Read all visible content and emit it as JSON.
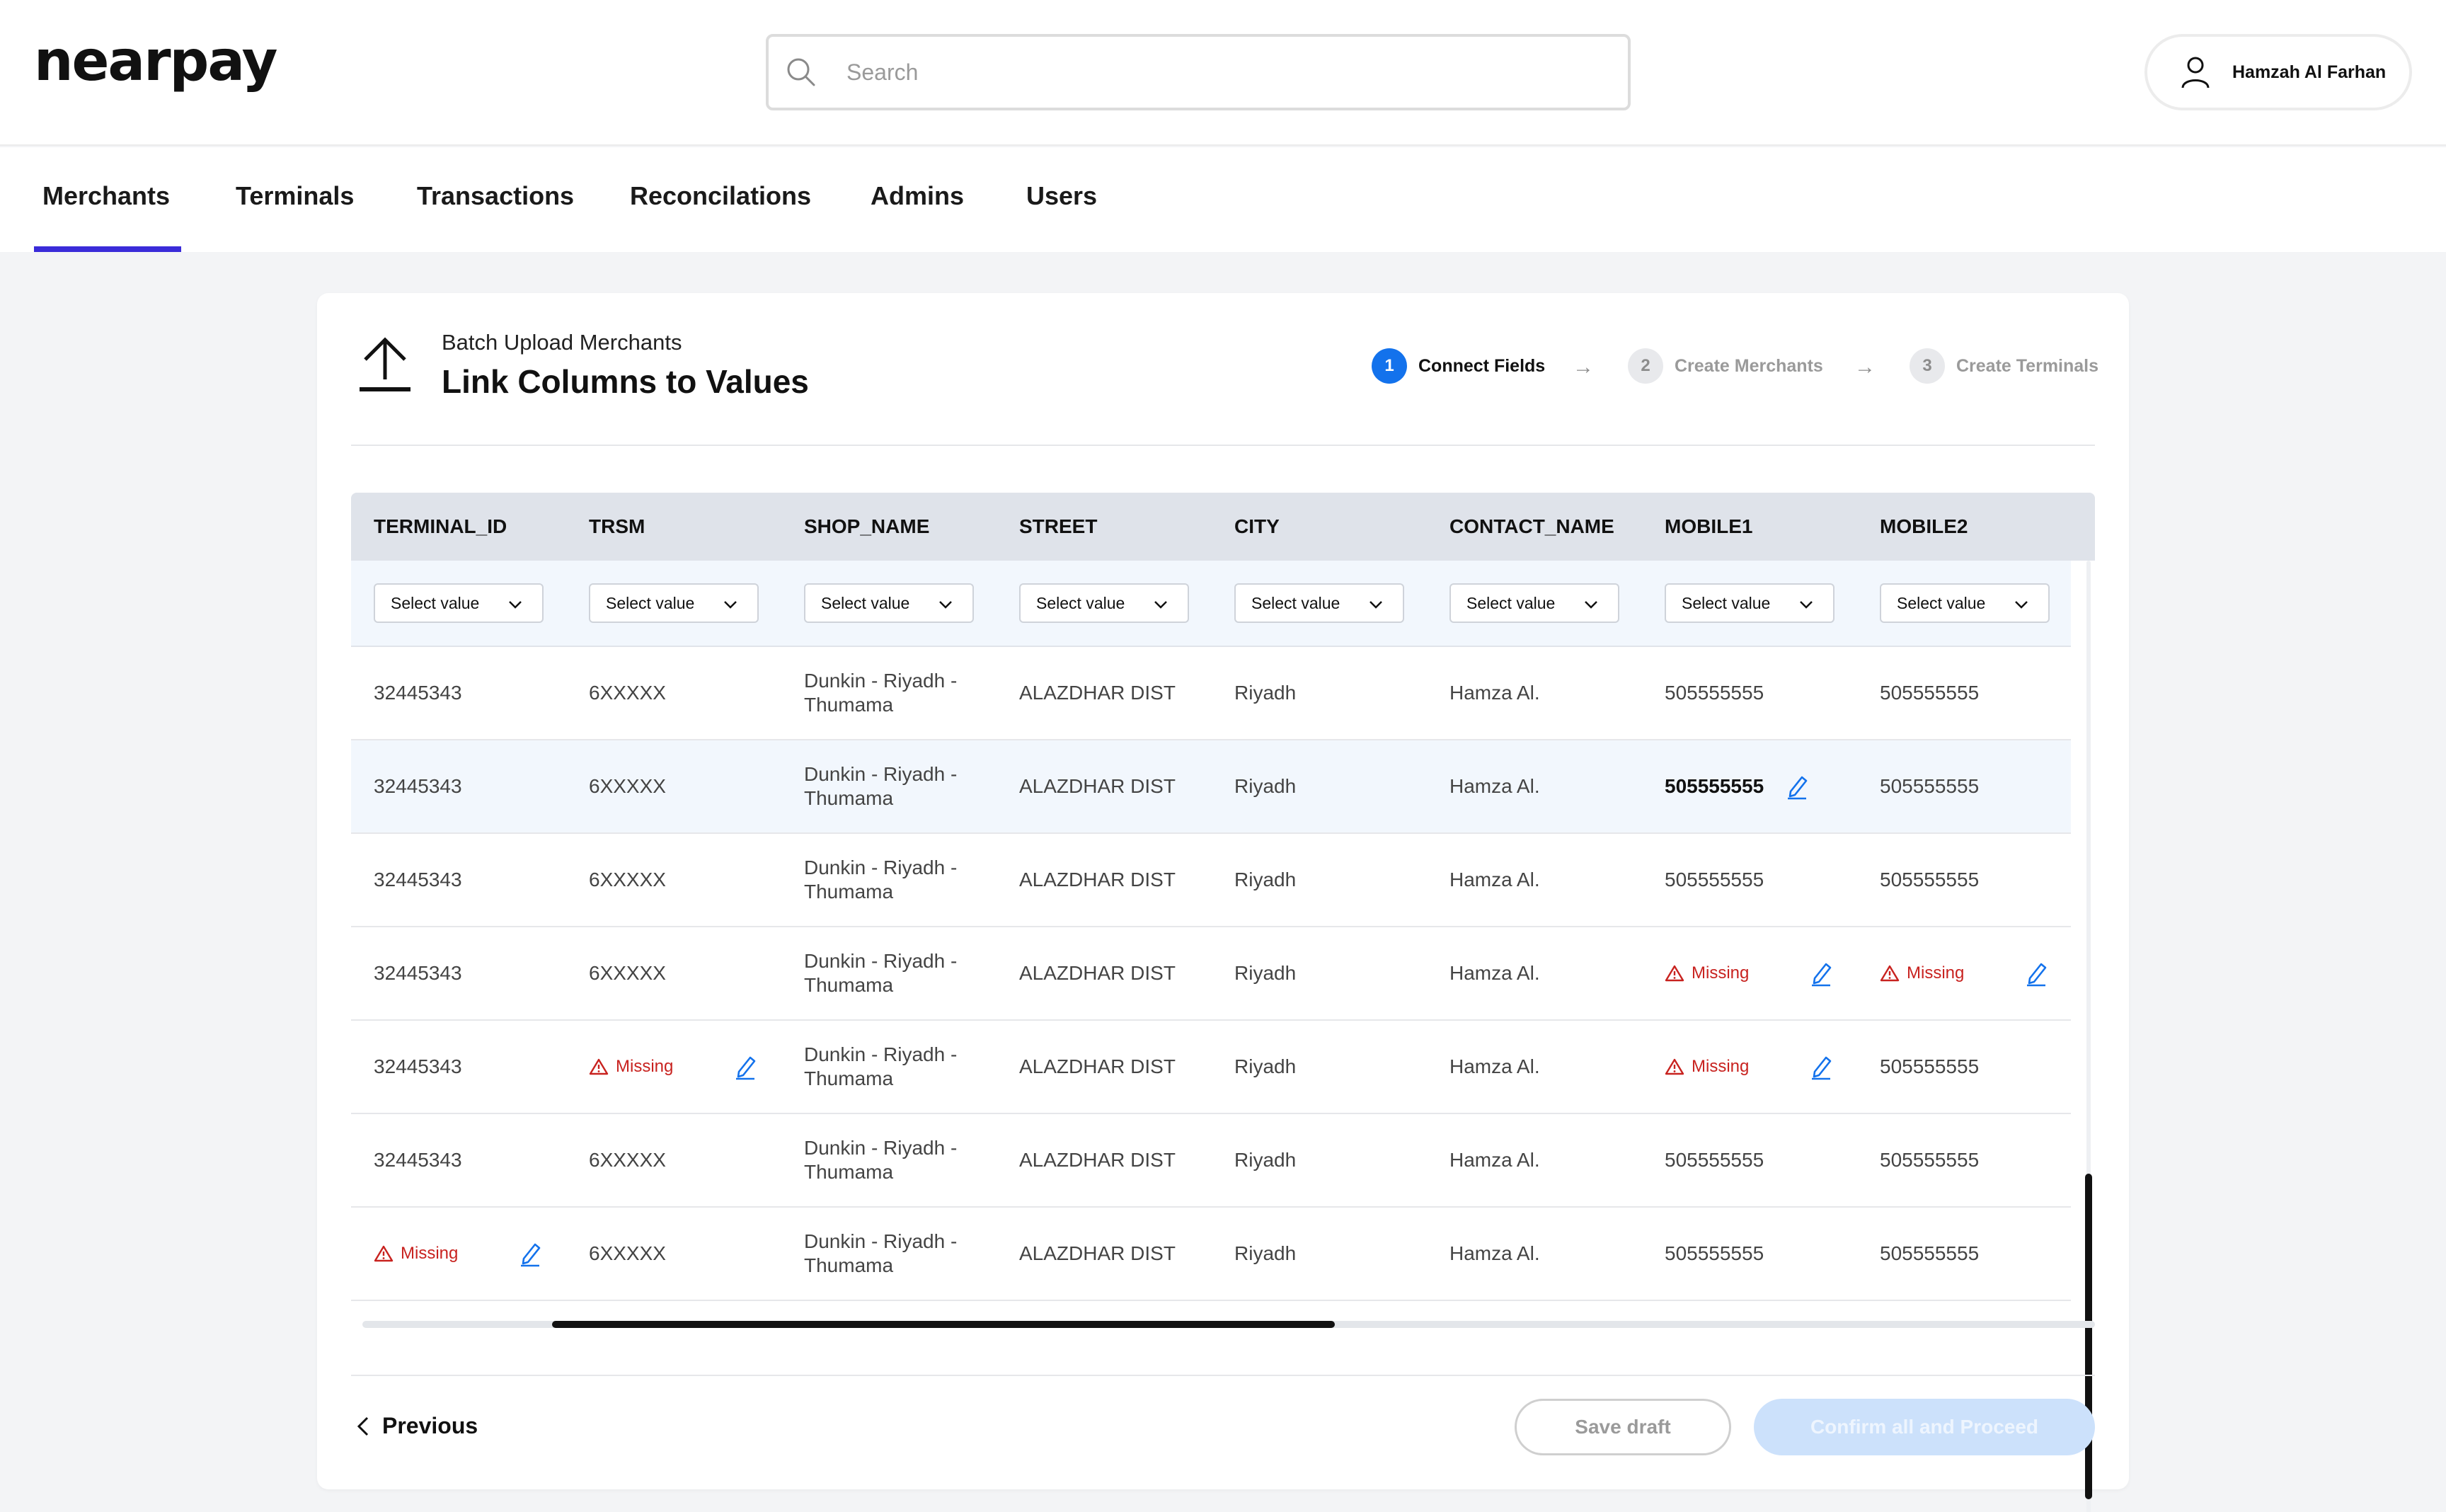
{
  "header": {
    "logo": "nearpay",
    "search_placeholder": "Search",
    "user_name": "Hamzah Al Farhan"
  },
  "nav": {
    "items": [
      {
        "label": "Merchants",
        "active": true
      },
      {
        "label": "Terminals",
        "active": false
      },
      {
        "label": "Transactions",
        "active": false
      },
      {
        "label": "Reconcilations",
        "active": false
      },
      {
        "label": "Admins",
        "active": false
      },
      {
        "label": "Users",
        "active": false
      }
    ]
  },
  "card": {
    "subtitle": "Batch Upload Merchants",
    "title": "Link Columns to Values"
  },
  "steps": [
    {
      "num": "1",
      "label": "Connect Fields",
      "active": true
    },
    {
      "num": "2",
      "label": "Create Merchants",
      "active": false
    },
    {
      "num": "3",
      "label": "Create Terminals",
      "active": false
    }
  ],
  "table": {
    "columns": [
      "TERMINAL_ID",
      "TRSM",
      "SHOP_NAME",
      "STREET",
      "CITY",
      "CONTACT_NAME",
      "MOBILE1",
      "MOBILE2"
    ],
    "select_placeholder": "Select value",
    "missing_label": "Missing",
    "rows": [
      [
        "32445343",
        "6XXXXX",
        "Dunkin - Riyadh - Thumama",
        "ALAZDHAR DIST",
        "Riyadh",
        "Hamza Al.",
        "505555555",
        "505555555"
      ],
      [
        "32445343",
        "6XXXXX",
        "Dunkin - Riyadh - Thumama",
        "ALAZDHAR DIST",
        "Riyadh",
        "Hamza Al.",
        "505555555",
        "505555555"
      ],
      [
        "32445343",
        "6XXXXX",
        "Dunkin - Riyadh - Thumama",
        "ALAZDHAR DIST",
        "Riyadh",
        "Hamza Al.",
        "505555555",
        "505555555"
      ],
      [
        "32445343",
        "6XXXXX",
        "Dunkin - Riyadh - Thumama",
        "ALAZDHAR DIST",
        "Riyadh",
        "Hamza Al.",
        "Missing",
        "Missing"
      ],
      [
        "32445343",
        "Missing",
        "Dunkin - Riyadh - Thumama",
        "ALAZDHAR DIST",
        "Riyadh",
        "Hamza Al.",
        "Missing",
        "505555555"
      ],
      [
        "32445343",
        "6XXXXX",
        "Dunkin - Riyadh - Thumama",
        "ALAZDHAR DIST",
        "Riyadh",
        "Hamza Al.",
        "505555555",
        "505555555"
      ],
      [
        "Missing",
        "6XXXXX",
        "Dunkin - Riyadh - Thumama",
        "ALAZDHAR DIST",
        "Riyadh",
        "Hamza Al.",
        "505555555",
        "505555555"
      ]
    ],
    "highlighted_row": 1,
    "editing_cell": {
      "row": 1,
      "col": 6
    }
  },
  "footer": {
    "previous_label": "Previous",
    "save_draft_label": "Save draft",
    "confirm_label": "Confirm all and Proceed"
  },
  "colors": {
    "accent": "#3a2bd9",
    "step_active": "#1372ec",
    "missing": "#c8221f",
    "edit_icon": "#1372ec",
    "confirm_disabled_bg": "#cce1fb"
  }
}
